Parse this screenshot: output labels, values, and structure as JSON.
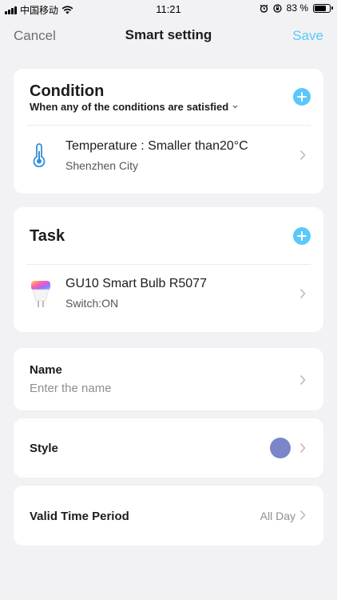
{
  "status_bar": {
    "carrier": "中国移动",
    "time": "11:21",
    "battery": "83 %",
    "battery_level": 0.83,
    "icons": [
      "signal-icon",
      "wifi-icon",
      "alarm-icon",
      "orientation-lock-icon",
      "battery-icon"
    ]
  },
  "nav": {
    "cancel": "Cancel",
    "title": "Smart setting",
    "save": "Save"
  },
  "condition": {
    "title": "Condition",
    "mode": "When any of the conditions are satisfied",
    "items": [
      {
        "icon": "thermometer-icon",
        "title": "Temperature : Smaller than20°C",
        "subtitle": "Shenzhen City"
      }
    ]
  },
  "task": {
    "title": "Task",
    "items": [
      {
        "icon": "smart-bulb-icon",
        "title": "GU10 Smart Bulb R5077",
        "subtitle": "Switch:ON"
      }
    ]
  },
  "name": {
    "label": "Name",
    "value": "",
    "placeholder": "Enter the name"
  },
  "style": {
    "label": "Style",
    "color": "#7b86c9"
  },
  "valid_time": {
    "label": "Valid Time Period",
    "value": "All Day"
  },
  "colors": {
    "accent": "#5ac8fa",
    "background": "#f2f2f4"
  }
}
